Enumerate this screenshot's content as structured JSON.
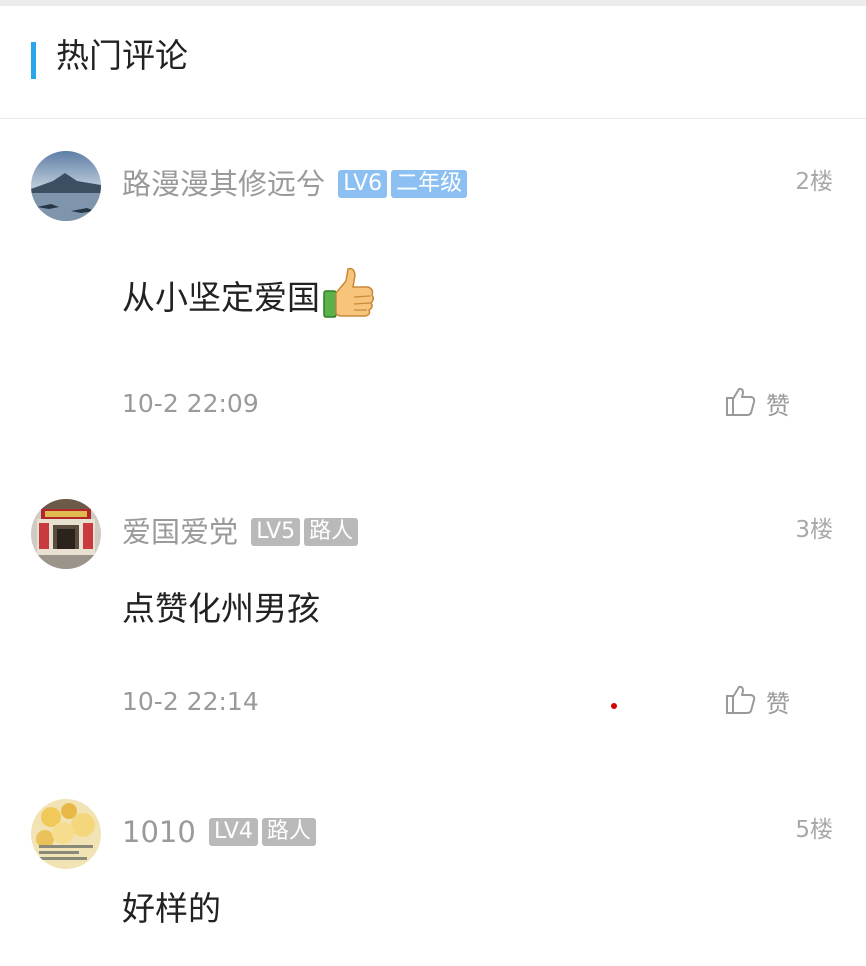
{
  "section": {
    "title": "热门评论"
  },
  "comments": [
    {
      "username": "路漫漫其修远兮",
      "badges": [
        "LV6",
        "二年级"
      ],
      "floor": "2楼",
      "content": "从小坚定爱国",
      "content_emoji": "thumbs-up-emoji",
      "time": "10-2 22:09",
      "like_label": "赞",
      "avatar": "landscape-avatar"
    },
    {
      "username": "爱国爱党",
      "badges": [
        "LV5",
        "路人"
      ],
      "floor": "3楼",
      "content": "点赞化州男孩",
      "time": "10-2 22:14",
      "like_label": "赞",
      "avatar": "building-avatar"
    },
    {
      "username": "1010",
      "badges": [
        "LV4",
        "路人"
      ],
      "floor": "5楼",
      "content": "好样的",
      "avatar": "floral-avatar"
    }
  ],
  "colors": {
    "accent": "#2aa7ea",
    "badge_level_blue": "#8cc0f2",
    "badge_gray": "#b9b9b9",
    "text_primary": "#222222",
    "text_secondary": "#9a9a9a"
  }
}
